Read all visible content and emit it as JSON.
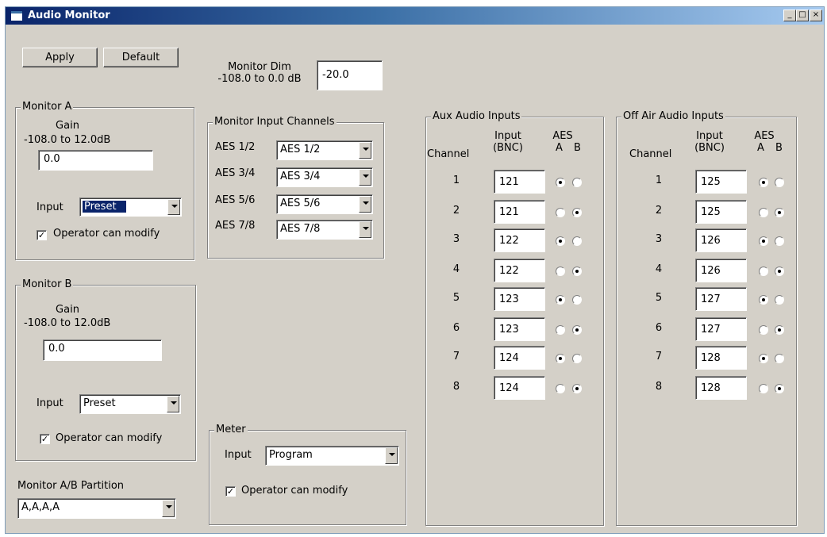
{
  "window": {
    "title": "Audio Monitor",
    "minimize": "_",
    "maximize": "□",
    "close": "×"
  },
  "toolbar": {
    "apply_label": "Apply",
    "default_label": "Default"
  },
  "monitor_dim": {
    "label_line1": "Monitor Dim",
    "label_line2": "-108.0 to 0.0 dB",
    "value": "-20.0"
  },
  "monitor_a": {
    "title": "Monitor A",
    "gain_label": "Gain",
    "gain_range": "-108.0 to 12.0dB",
    "gain_value": "0.0",
    "input_label": "Input",
    "input_value": "Preset",
    "modify_label": "Operator can modify",
    "modify_checked": true
  },
  "monitor_b": {
    "title": "Monitor B",
    "gain_label": "Gain",
    "gain_range": "-108.0 to 12.0dB",
    "gain_value": "0.0",
    "input_label": "Input",
    "input_value": "Preset",
    "modify_label": "Operator can modify",
    "modify_checked": true
  },
  "partition": {
    "label": "Monitor A/B Partition",
    "value": "A,A,A,A"
  },
  "input_channels": {
    "title": "Monitor Input Channels",
    "rows": [
      {
        "label": "AES 1/2",
        "value": "AES 1/2"
      },
      {
        "label": "AES 3/4",
        "value": "AES 3/4"
      },
      {
        "label": "AES 5/6",
        "value": "AES 5/6"
      },
      {
        "label": "AES 7/8",
        "value": "AES 7/8"
      }
    ]
  },
  "meter": {
    "title": "Meter",
    "input_label": "Input",
    "input_value": "Program",
    "modify_label": "Operator can modify",
    "modify_checked": true
  },
  "aux_inputs": {
    "title": "Aux Audio Inputs",
    "col_channel": "Channel",
    "col_input_1": "Input",
    "col_input_2": "(BNC)",
    "col_aes": "AES",
    "col_a": "A",
    "col_b": "B",
    "rows": [
      {
        "channel": "1",
        "input": "121",
        "aes": "A"
      },
      {
        "channel": "2",
        "input": "121",
        "aes": "B"
      },
      {
        "channel": "3",
        "input": "122",
        "aes": "A"
      },
      {
        "channel": "4",
        "input": "122",
        "aes": "B"
      },
      {
        "channel": "5",
        "input": "123",
        "aes": "A"
      },
      {
        "channel": "6",
        "input": "123",
        "aes": "B"
      },
      {
        "channel": "7",
        "input": "124",
        "aes": "A"
      },
      {
        "channel": "8",
        "input": "124",
        "aes": "B"
      }
    ]
  },
  "offair_inputs": {
    "title": "Off Air Audio Inputs",
    "col_channel": "Channel",
    "col_input_1": "Input",
    "col_input_2": "(BNC)",
    "col_aes": "AES",
    "col_a": "A",
    "col_b": "B",
    "rows": [
      {
        "channel": "1",
        "input": "125",
        "aes": "A"
      },
      {
        "channel": "2",
        "input": "125",
        "aes": "B"
      },
      {
        "channel": "3",
        "input": "126",
        "aes": "A"
      },
      {
        "channel": "4",
        "input": "126",
        "aes": "B"
      },
      {
        "channel": "5",
        "input": "127",
        "aes": "A"
      },
      {
        "channel": "6",
        "input": "127",
        "aes": "B"
      },
      {
        "channel": "7",
        "input": "128",
        "aes": "A"
      },
      {
        "channel": "8",
        "input": "128",
        "aes": "B"
      }
    ]
  }
}
